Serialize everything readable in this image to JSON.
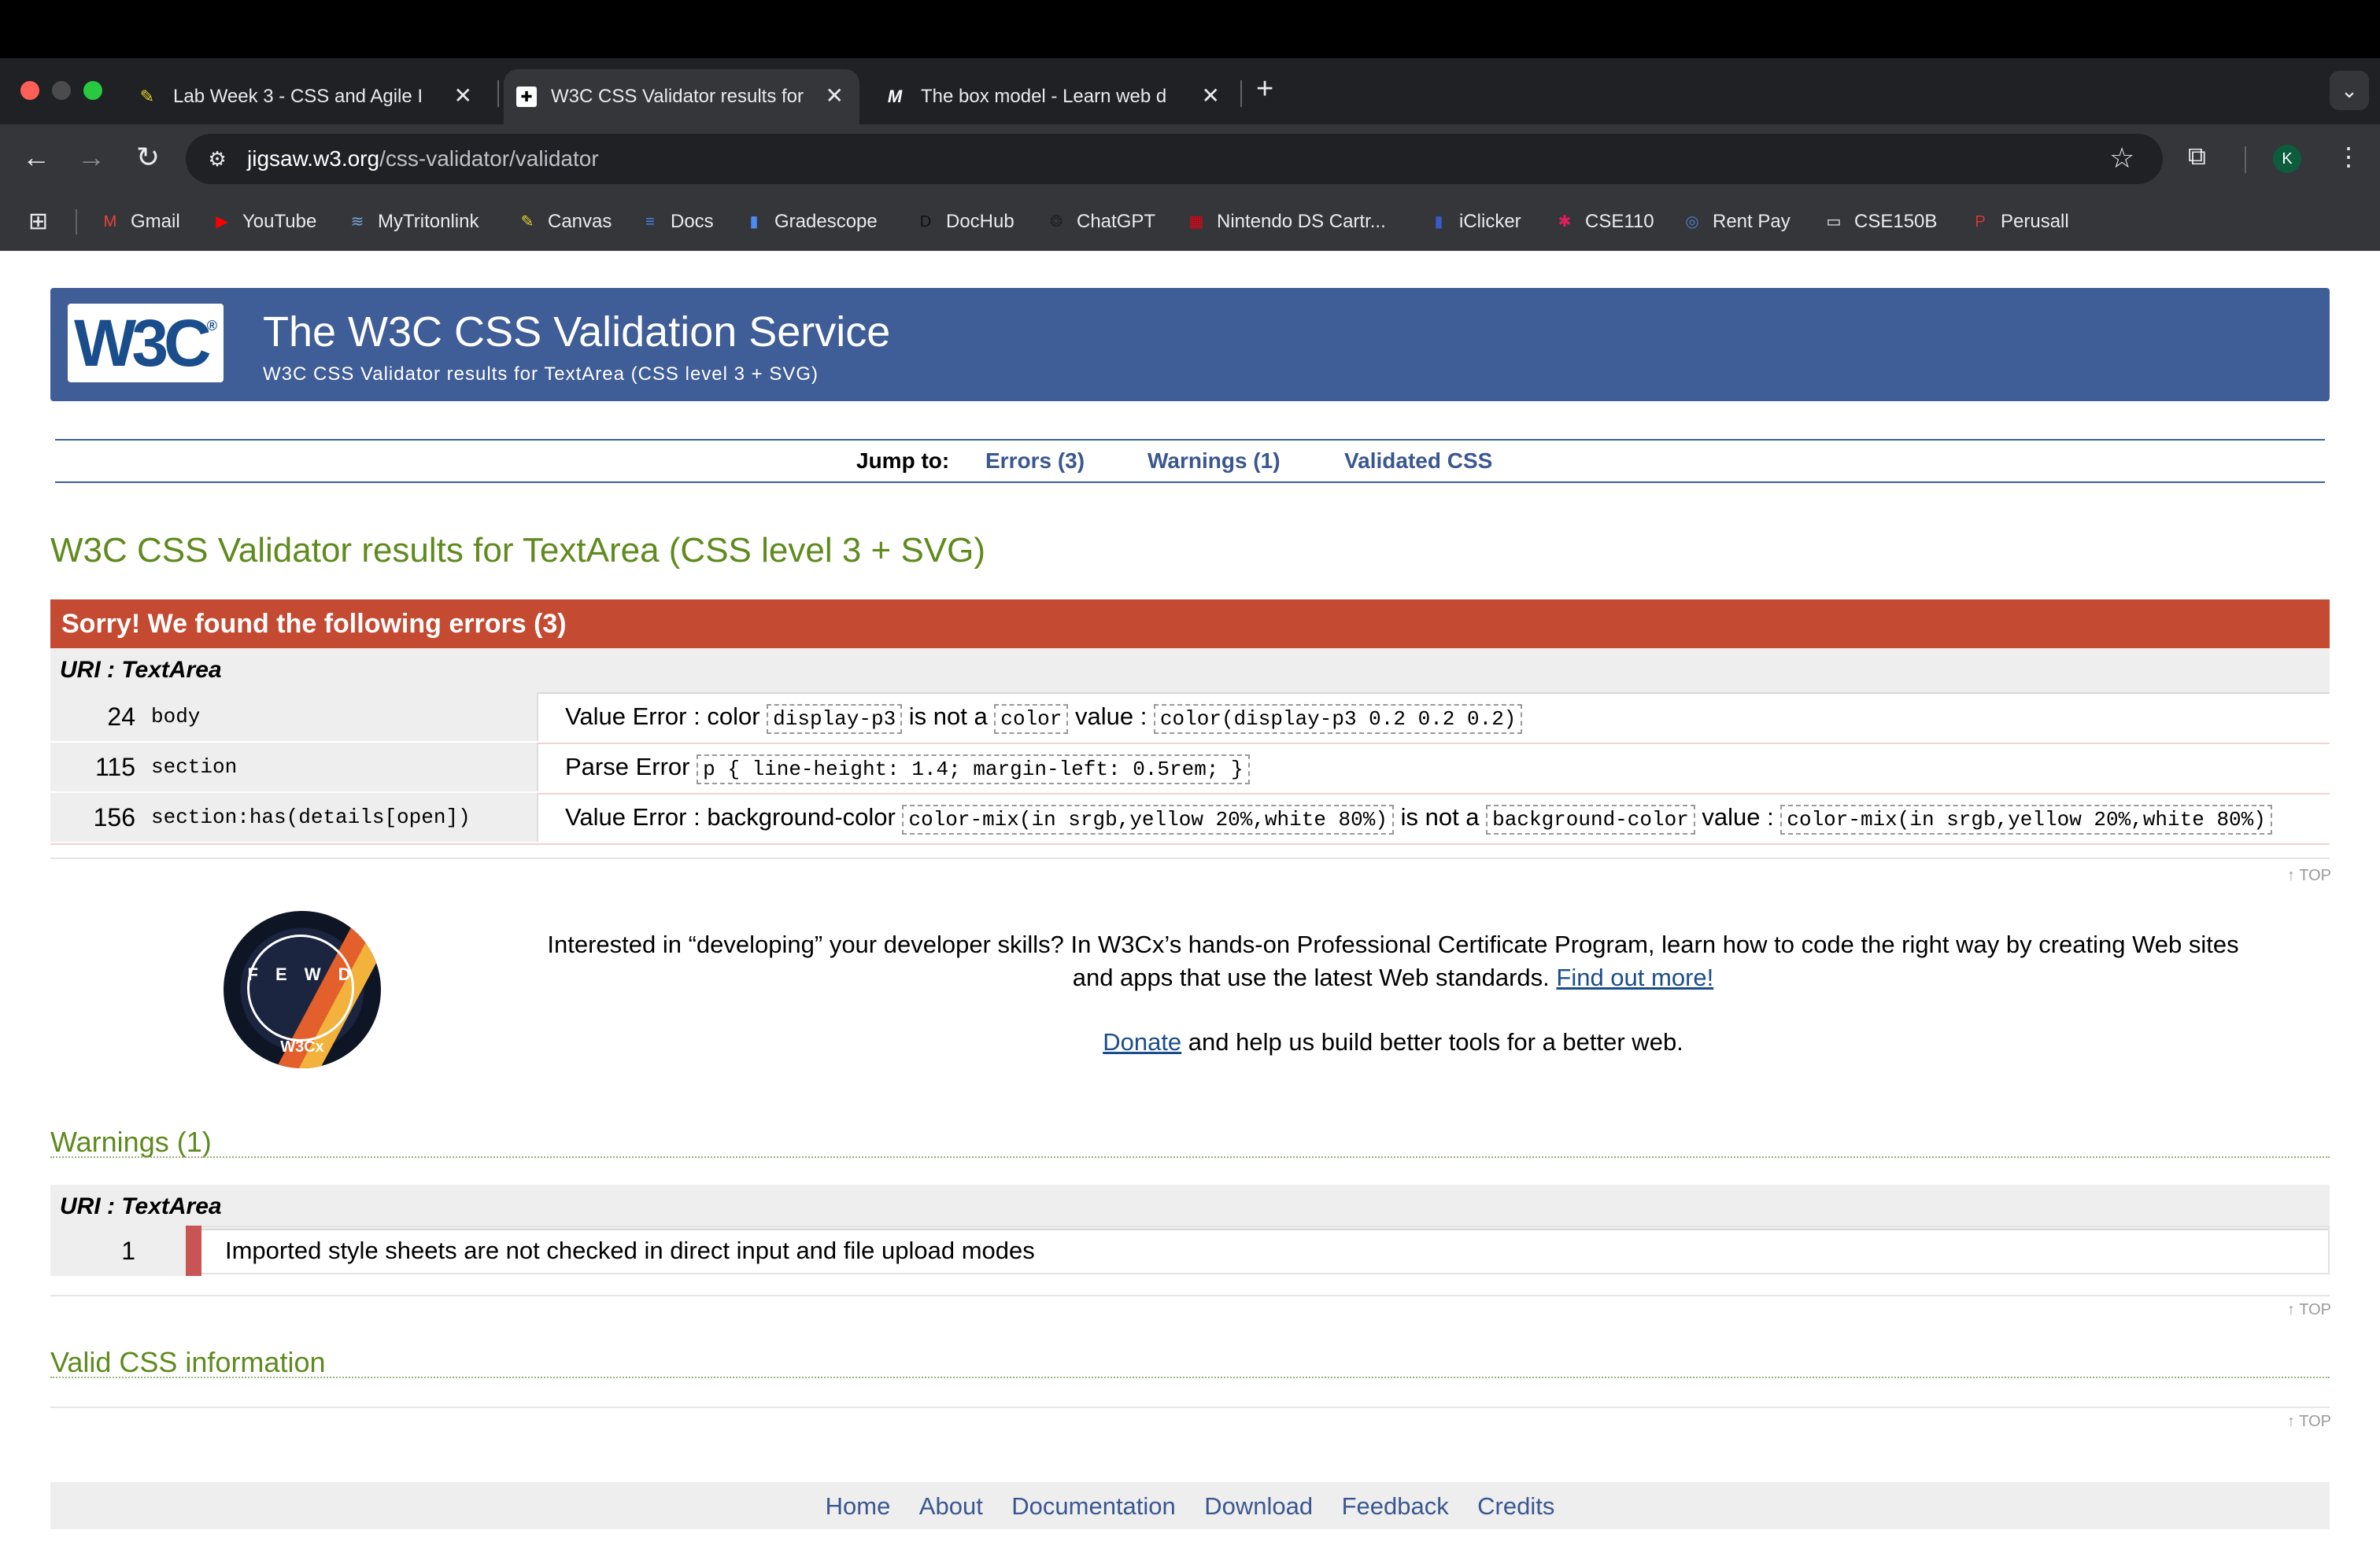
{
  "browser": {
    "tabs": [
      {
        "title": "Lab Week 3 - CSS and Agile I",
        "favicon": "canvas-icon",
        "active": false
      },
      {
        "title": "W3C CSS Validator results for",
        "favicon": "w3c-icon",
        "active": true
      },
      {
        "title": "The box model - Learn web d",
        "favicon": "mdn-icon",
        "active": false
      }
    ],
    "url_host": "jigsaw.w3.org",
    "url_path": "/css-validator/validator",
    "profile_initial": "K",
    "bookmarks": [
      {
        "label": "Gmail",
        "icon": "gmail-icon",
        "color": "#ea4335"
      },
      {
        "label": "YouTube",
        "icon": "youtube-icon",
        "color": "#ff0000"
      },
      {
        "label": "MyTritonlink",
        "icon": "triton-icon",
        "color": "#7aa7d8"
      },
      {
        "label": "Canvas",
        "icon": "canvas-icon",
        "color": "#e2d32f"
      },
      {
        "label": "Docs",
        "icon": "docs-icon",
        "color": "#4285f4"
      },
      {
        "label": "Gradescope",
        "icon": "gradescope-icon",
        "color": "#4c8bf5"
      },
      {
        "label": "DocHub",
        "icon": "dochub-icon",
        "color": "#111111"
      },
      {
        "label": "ChatGPT",
        "icon": "chatgpt-icon",
        "color": "#202124"
      },
      {
        "label": "Nintendo DS Cartr...",
        "icon": "nintendo-icon",
        "color": "#e60012"
      },
      {
        "label": "iClicker",
        "icon": "iclicker-icon",
        "color": "#3a5bc7"
      },
      {
        "label": "CSE110",
        "icon": "slack-icon",
        "color": "#e01e5a"
      },
      {
        "label": "Rent Pay",
        "icon": "rentpay-icon",
        "color": "#4a7fd1"
      },
      {
        "label": "CSE150B",
        "icon": "folder-icon",
        "color": "#e8eaed"
      },
      {
        "label": "Perusall",
        "icon": "perusall-icon",
        "color": "#d93434"
      }
    ]
  },
  "header": {
    "logo_text": "W3C",
    "title": "The W3C CSS Validation Service",
    "subtitle": "W3C CSS Validator results for TextArea (CSS level 3 + SVG)"
  },
  "jump": {
    "label": "Jump to:",
    "links": [
      "Errors (3)",
      "Warnings (1)",
      "Validated CSS"
    ]
  },
  "results_title": "W3C CSS Validator results for TextArea (CSS level 3 + SVG)",
  "errors": {
    "heading": "Sorry! We found the following errors (3)",
    "uri": "URI : TextArea",
    "rows": [
      {
        "line": "24",
        "context": "body",
        "parts": [
          {
            "t": "text",
            "v": "Value Error : color "
          },
          {
            "t": "code",
            "v": "display-p3"
          },
          {
            "t": "text",
            "v": " is not a "
          },
          {
            "t": "code",
            "v": "color"
          },
          {
            "t": "text",
            "v": " value : "
          },
          {
            "t": "code",
            "v": "color(display-p3 0.2 0.2 0.2)"
          }
        ]
      },
      {
        "line": "115",
        "context": "section",
        "parts": [
          {
            "t": "text",
            "v": "Parse Error "
          },
          {
            "t": "code",
            "v": "p { line-height: 1.4; margin-left: 0.5rem; }"
          }
        ]
      },
      {
        "line": "156",
        "context": "section:has(details[open])",
        "parts": [
          {
            "t": "text",
            "v": "Value Error : background-color "
          },
          {
            "t": "code",
            "v": "color-mix(in srgb,yellow 20%,white 80%)"
          },
          {
            "t": "text",
            "v": " is not a "
          },
          {
            "t": "code",
            "v": "background-color"
          },
          {
            "t": "text",
            "v": " value : "
          },
          {
            "t": "code",
            "v": "color-mix(in srgb,yellow 20%,white 80%)"
          }
        ]
      }
    ]
  },
  "top_label": "↑ TOP",
  "promo": {
    "badge_letters": "F E W D",
    "badge_brand": "W3Cx",
    "line1": "Interested in “developing” your developer skills? In W3Cx’s hands-on Professional Certificate Program, learn how to code the right way by creating Web sites",
    "line2": "and apps that use the latest Web standards.",
    "link": "Find out more!",
    "donate_link": "Donate",
    "donate_text": " and help us build better tools for a better web."
  },
  "warnings": {
    "heading": "Warnings (1)",
    "uri": "URI : TextArea",
    "rows": [
      {
        "line": "1",
        "message": "Imported style sheets are not checked in direct input and file upload modes"
      }
    ]
  },
  "valid_heading": "Valid CSS information",
  "footer": {
    "links": [
      "Home",
      "About",
      "Documentation",
      "Download",
      "Feedback",
      "Credits"
    ]
  },
  "colors": {
    "banner": "#3f5d97",
    "error_header": "#c44a31",
    "section_heading": "#5f8a1d",
    "link": "#3a5790"
  }
}
